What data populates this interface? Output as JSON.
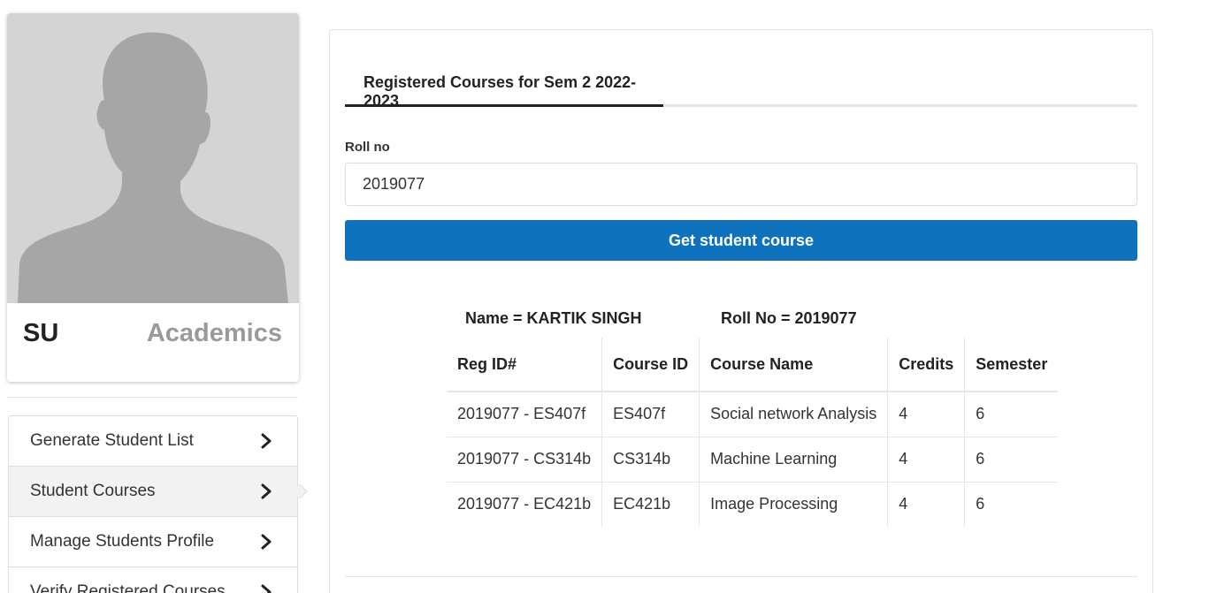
{
  "profile": {
    "name": "SU",
    "role": "Academics"
  },
  "sidebar": {
    "items": [
      {
        "label": "Generate Student List",
        "active": false
      },
      {
        "label": "Student Courses",
        "active": true
      },
      {
        "label": "Manage Students Profile",
        "active": false
      },
      {
        "label": "Verify Registered Courses",
        "active": false
      }
    ]
  },
  "main": {
    "tab_label": "Registered Courses for Sem 2 2022-2023",
    "roll_label": "Roll no",
    "roll_value": "2019077",
    "button_label": "Get student course",
    "student_name": "Name = KARTIK SINGH",
    "student_roll": "Roll No = 2019077",
    "table": {
      "headers": [
        "Reg ID#",
        "Course ID",
        "Course Name",
        "Credits",
        "Semester"
      ],
      "rows": [
        [
          "2019077 - ES407f",
          "ES407f",
          "Social network Analysis",
          "4",
          "6"
        ],
        [
          "2019077 - CS314b",
          "CS314b",
          "Machine Learning",
          "4",
          "6"
        ],
        [
          "2019077 - EC421b",
          "EC421b",
          "Image Processing",
          "4",
          "6"
        ]
      ]
    }
  },
  "colors": {
    "primary_button": "#0e72bd",
    "avatar_bg": "#d4d4d4",
    "avatar_silhouette": "#a6a6a6",
    "role_text": "#9a9a9a"
  },
  "icons": {
    "avatar": "person-silhouette-icon",
    "menu_chevron": "chevron-right-icon"
  }
}
